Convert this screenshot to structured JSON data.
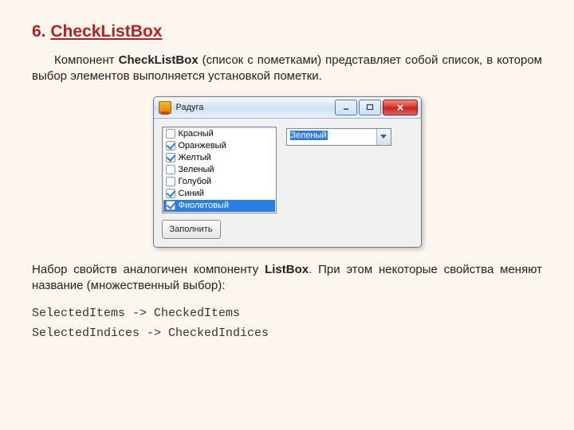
{
  "heading_num": "6. ",
  "heading_text": "CheckListBox",
  "para1_a": "Компонент ",
  "para1_bold": "CheckListBox",
  "para1_b": " (список с пометками) представляет собой список, в котором выбор элементов выполняется установкой пометки.",
  "window": {
    "title": "Радуга",
    "items": [
      {
        "label": "Красный",
        "checked": false,
        "selected": false
      },
      {
        "label": "Оранжевый",
        "checked": true,
        "selected": false
      },
      {
        "label": "Желтый",
        "checked": true,
        "selected": false
      },
      {
        "label": "Зеленый",
        "checked": false,
        "selected": false
      },
      {
        "label": "Голубой",
        "checked": false,
        "selected": false
      },
      {
        "label": "Синий",
        "checked": true,
        "selected": false
      },
      {
        "label": "Фиолетовый",
        "checked": true,
        "selected": true
      }
    ],
    "fill_button": "Заполнить",
    "combo_value": "Зеленый"
  },
  "para2_a": "Набор свойств аналогичен компоненту ",
  "para2_bold": "ListBox",
  "para2_b": ". При этом некоторые свойства меняют название (множественный выбор):",
  "code1": "SelectedItems -> CheckedItems",
  "code2": "SelectedIndices -> CheckedIndices"
}
